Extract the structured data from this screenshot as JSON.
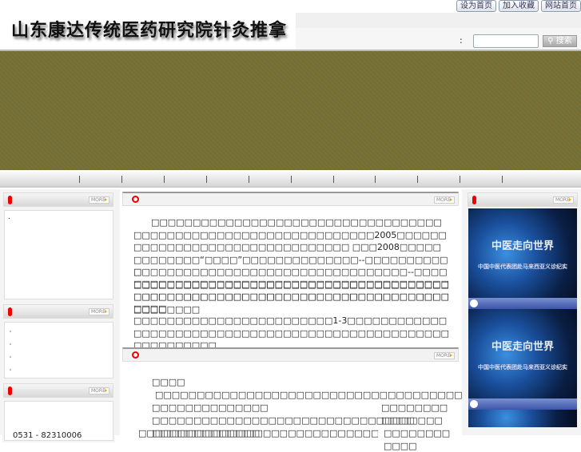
{
  "top_links": [
    "设为首页",
    "加入收藏",
    "网站首页"
  ],
  "logo_text": "山东康达传统医药研究院针灸推拿",
  "search": {
    "label": ":",
    "placeholder": "",
    "button": "搜索"
  },
  "more_label": "MORE",
  "center": {
    "p1": "□□□□□□□□□□□□□□□□□□□□□□□□□□□□□□□□□□□□□□□□□□□□□□□□□□□□□□□□□□□□□□□□2005□□□□□□□□□□□□□□□□□□□□□□□□□□□□□□□□ □□□2008□□□□□□□□□□□□□“□□□□”□□□□□□□□□□□□□□--□□□□□□□□□□□□□□□□□□□□□□□□□□□□□□□□□□□□□□□□□□□--□□□□□□□□□□□□□□□□□□□□□□□□□□□□□□□□□□□□□□□□□□□□□□□□□□□□□□□□□□□□□□□□□□□□□□□□□□□□□□□□□□□□□□□□",
    "p1b": "□",
    "p2": "□□□□□□□□□□□□□□□□□□□□□□□□□□□□□□□□□□□□□□□□□□□□□□□□□□□□□□□□□□□□□□□□□□□□□□□□□□□□□□□□",
    "p3": "□□□□□□□□□□□□□□□□□□□□□□□□1-3□□□□□□□□□□□□□□□□□□□□□□□□□□□□□□□□□□□□□□□□□□□□□□□□□□□□□□□□□□□□",
    "s2_l1": "□□□□",
    "s2_l2": "□□□□□□□□□□□□□□□□□□□□□□□□□□□□□□□□□□□□□",
    "s2_l3a": "□□□□□□□□□□□□□□",
    "s2_l3b": "□□□□□□□□□□□□",
    "s2_l4": "□□□□□□□□□□□□□□□□□□□□□□□□□□□□□□□□□□□□□□□□□□□□□□□□",
    "s2_l5a": "□□□□□□□□□□□□□□□□□□□□□□□□□□□□□□□□□□□□□□□□□□□□□",
    "s2_l5b": "□□□□□□□□□□□□"
  },
  "left": {
    "item1": ".",
    "contact": "0531 - 82310006"
  },
  "video": {
    "title": "中医走向世界",
    "subtitle": "中国中医代表团赴马来西亚义诊纪实"
  }
}
